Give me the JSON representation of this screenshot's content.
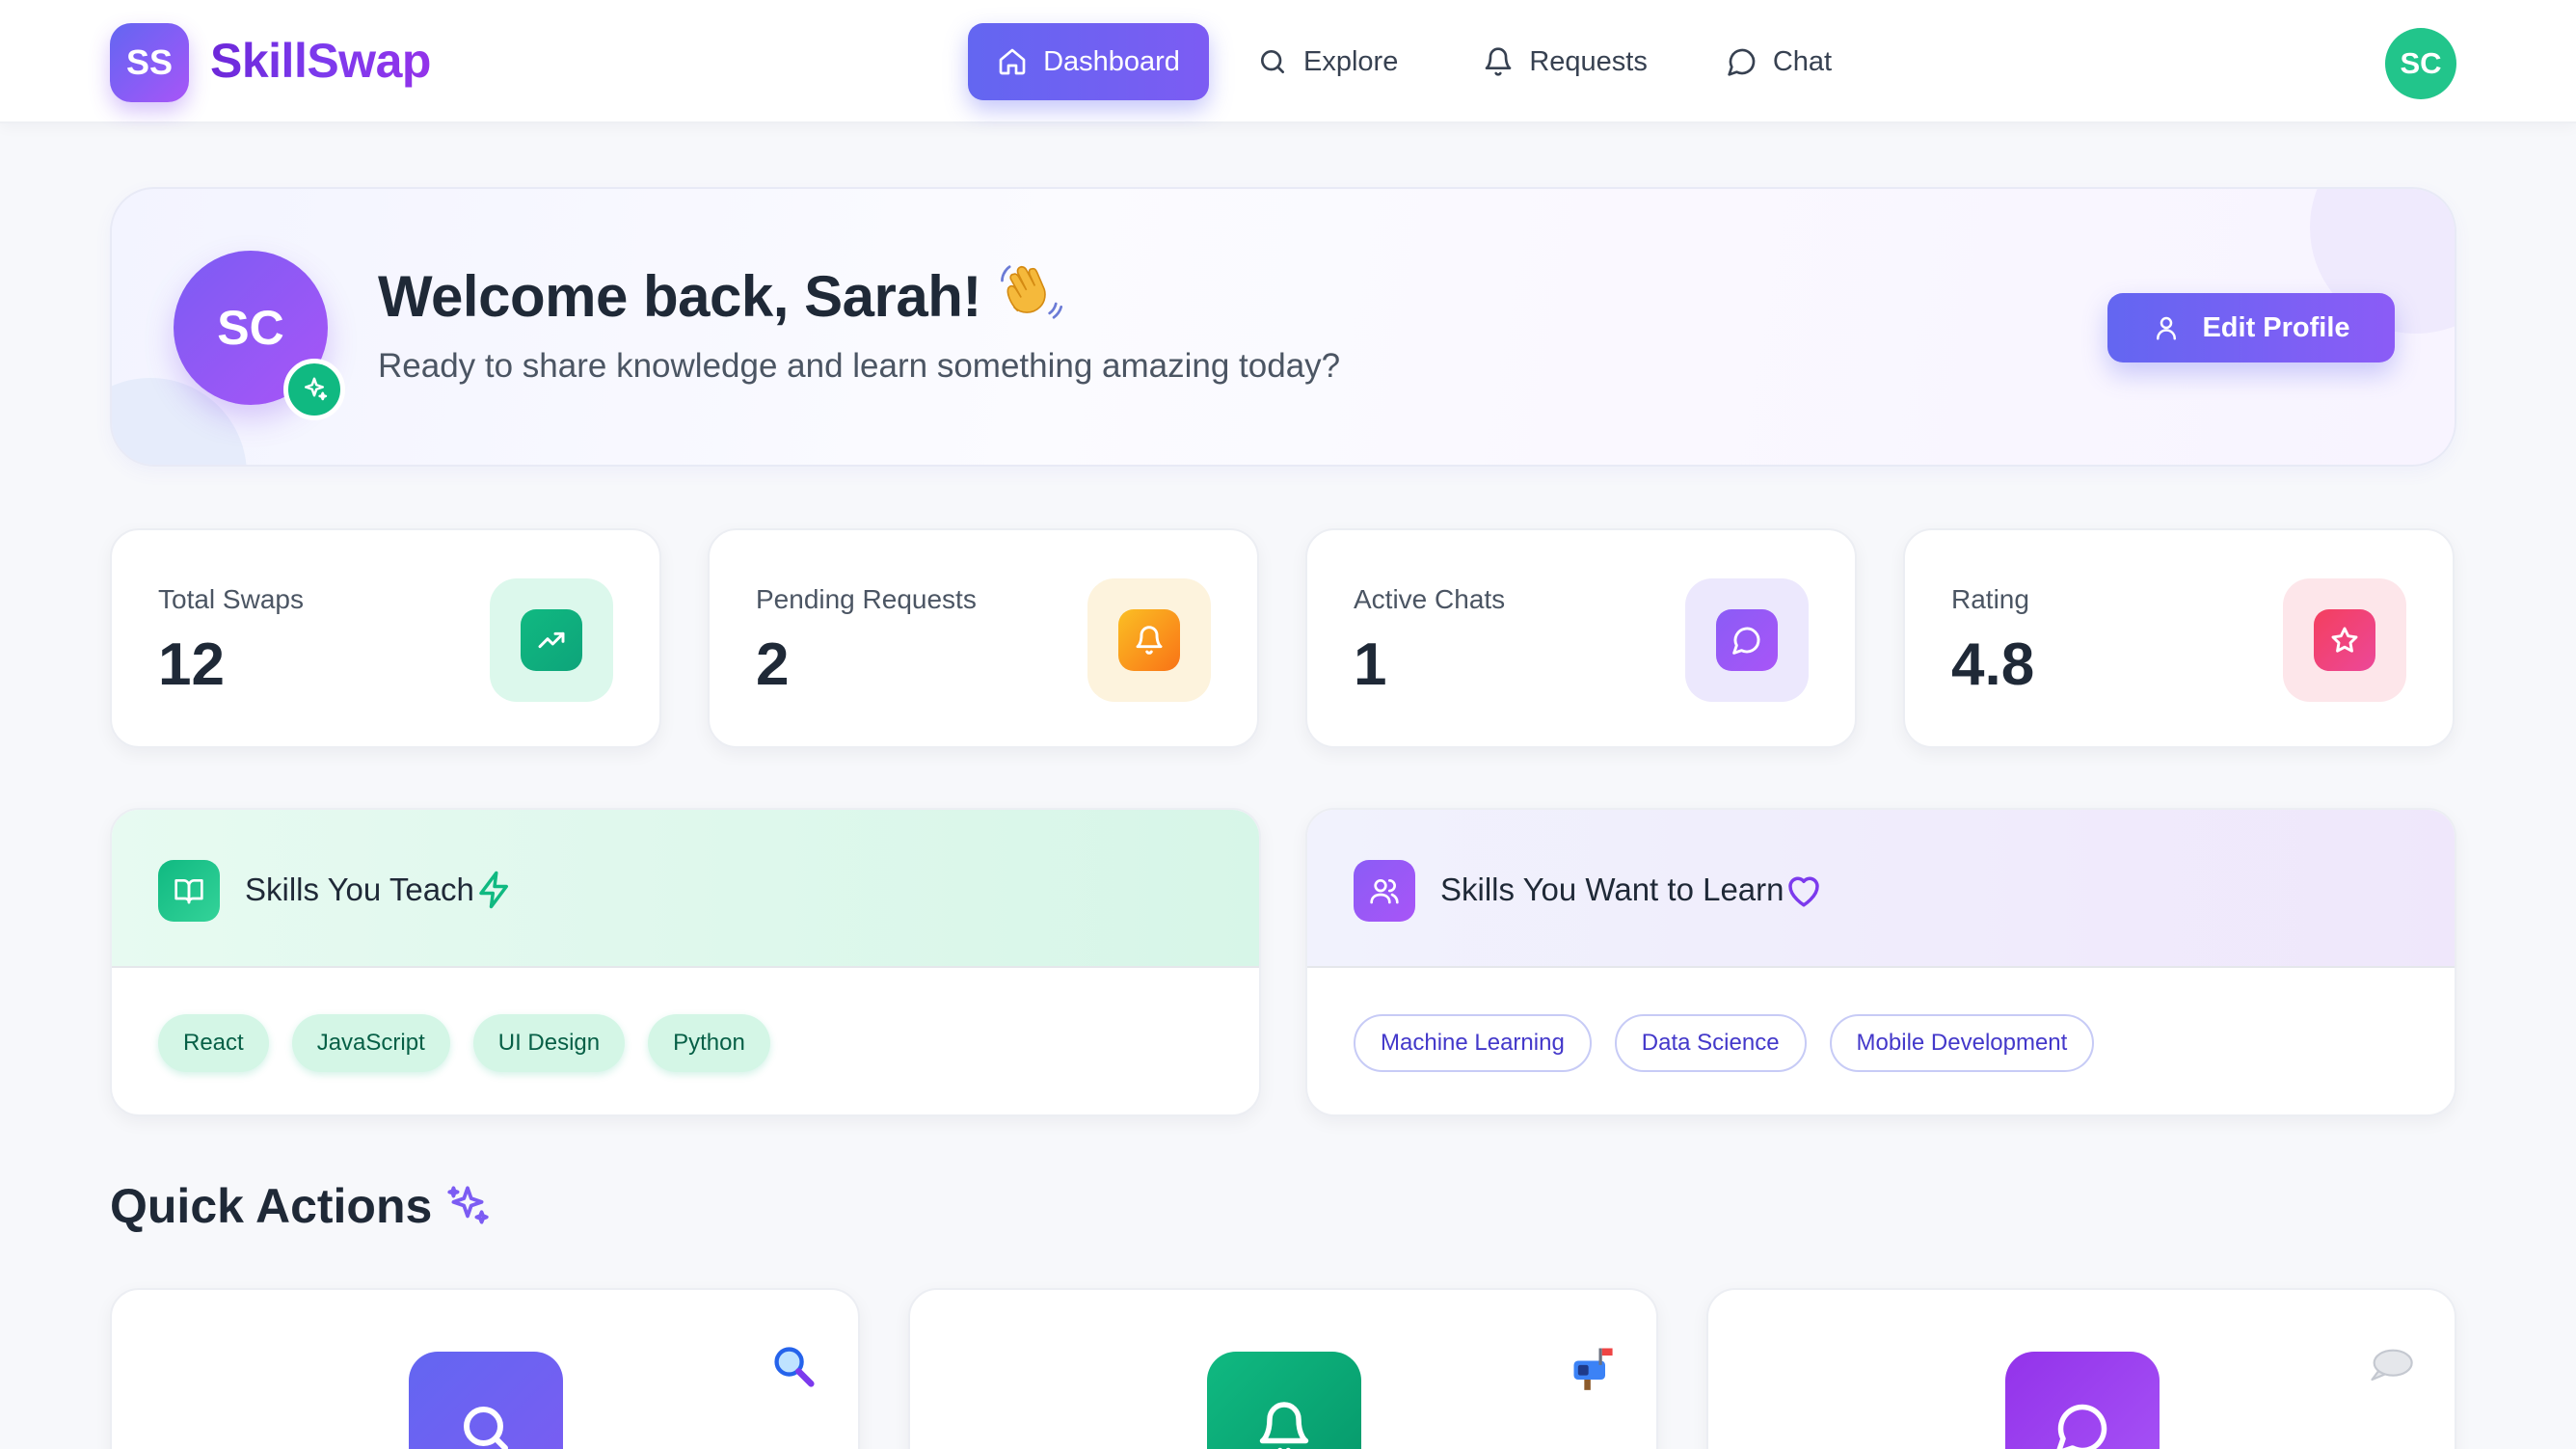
{
  "app": {
    "logo_initials": "SS",
    "brand": "SkillSwap",
    "accent": "#6366f1",
    "success": "#10b981"
  },
  "nav": {
    "items": [
      {
        "label": "Dashboard",
        "icon": "home-icon",
        "active": true
      },
      {
        "label": "Explore",
        "icon": "search-icon",
        "active": false
      },
      {
        "label": "Requests",
        "icon": "bell-icon",
        "active": false
      },
      {
        "label": "Chat",
        "icon": "message-circle-icon",
        "active": false
      }
    ],
    "user_initials": "SC"
  },
  "welcome": {
    "avatar_initials": "SC",
    "badge_icon": "sparkles-icon",
    "title": "Welcome back, Sarah!",
    "wave_icon": "waving-hand-icon",
    "subtitle": "Ready to share knowledge and learn something amazing today?",
    "edit_button": "Edit Profile",
    "edit_icon": "user-icon"
  },
  "stats": [
    {
      "label": "Total Swaps",
      "value": "12",
      "icon": "trending-up-icon",
      "color": "#10b981"
    },
    {
      "label": "Pending Requests",
      "value": "2",
      "icon": "bell-icon",
      "color": "#f59e0b"
    },
    {
      "label": "Active Chats",
      "value": "1",
      "icon": "message-circle-icon",
      "color": "#8b5cf6"
    },
    {
      "label": "Rating",
      "value": "4.8",
      "icon": "star-icon",
      "color": "#f43f5e"
    }
  ],
  "skills_teach": {
    "title": "Skills You Teach",
    "icon": "book-open-icon",
    "accent_icon": "zap-icon",
    "tags": [
      "React",
      "JavaScript",
      "UI Design",
      "Python"
    ]
  },
  "skills_learn": {
    "title": "Skills You Want to Learn",
    "icon": "users-icon",
    "accent_icon": "heart-icon",
    "tags": [
      "Machine Learning",
      "Data Science",
      "Mobile Development"
    ]
  },
  "quick_actions": {
    "title": "Quick Actions",
    "title_icon": "sparkles-icon",
    "cards": [
      {
        "icon": "search-icon",
        "emoji": "magnifying-glass-emoji",
        "color": "#6366f1"
      },
      {
        "icon": "bell-icon",
        "emoji": "mailbox-emoji",
        "color": "#10b981"
      },
      {
        "icon": "message-circle-icon",
        "emoji": "speech-bubble-emoji",
        "color": "#9333ea"
      }
    ]
  }
}
